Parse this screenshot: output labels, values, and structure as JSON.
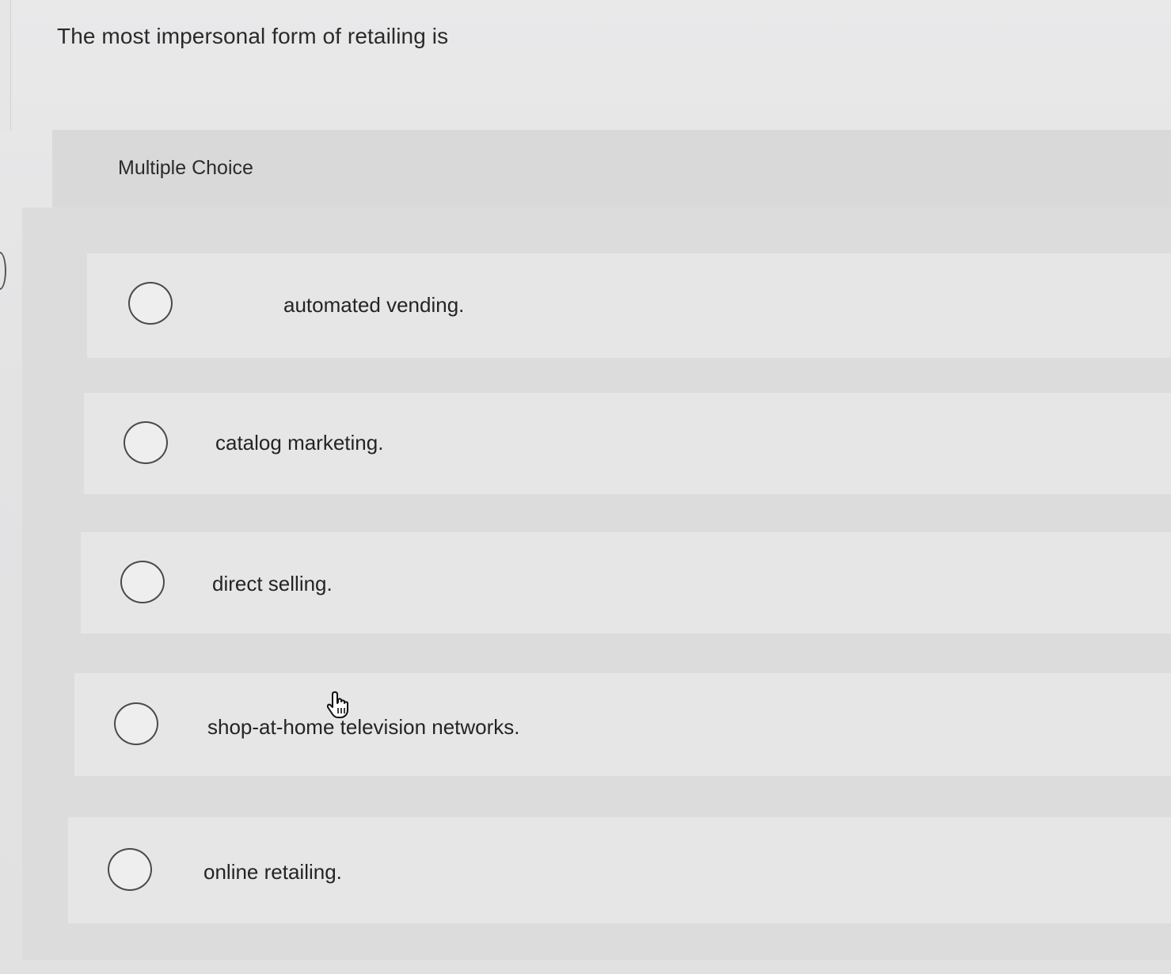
{
  "question": {
    "text": "The most impersonal form of retailing is"
  },
  "question_type": "Multiple Choice",
  "options": [
    {
      "label": "automated vending.",
      "selected": false
    },
    {
      "label": "catalog marketing.",
      "selected": false
    },
    {
      "label": "direct selling.",
      "selected": false
    },
    {
      "label": "shop-at-home television networks.",
      "selected": false
    },
    {
      "label": "online retailing.",
      "selected": false
    }
  ],
  "icons": {
    "cursor": "hand-pointer-icon",
    "radio": "radio-button-icon"
  },
  "colors": {
    "background": "#e4e4e5",
    "panel": "#dcdcdd",
    "option_row": "#e6e6e7",
    "text": "#242424",
    "radio_border": "#4a4a4a"
  }
}
